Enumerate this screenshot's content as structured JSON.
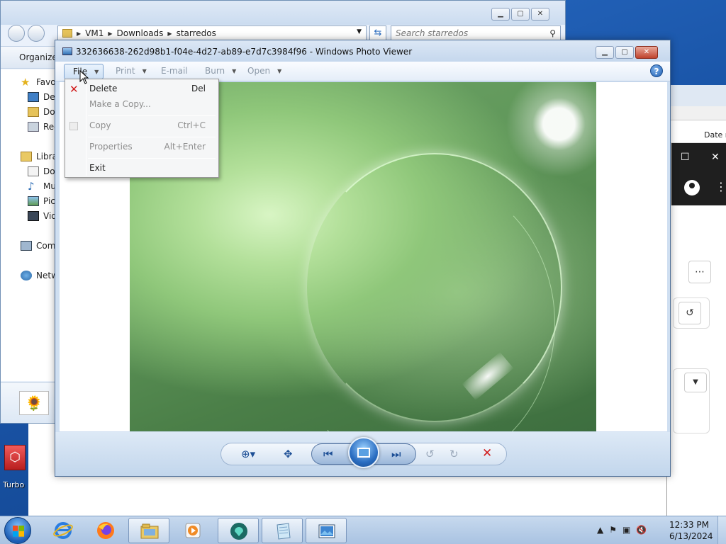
{
  "explorer": {
    "breadcrumb": [
      "VM1",
      "Downloads",
      "starredos"
    ],
    "search_placeholder": "Search starredos",
    "toolbar_organize": "Organize",
    "nav_items": [
      "Favor",
      "Des",
      "Dow",
      "Rec",
      "Libra",
      "Doc",
      "Mu",
      "Pict",
      "Vid",
      "Comp",
      "Netw"
    ]
  },
  "browser": {
    "column_header": "Date r"
  },
  "viewer": {
    "title": "332636638-262d98b1-f04e-4d27-ab89-e7d7c3984f96 - Windows Photo Viewer",
    "menus": {
      "file": "File",
      "print": "Print",
      "email": "E-mail",
      "burn": "Burn",
      "open": "Open"
    }
  },
  "file_menu": {
    "items": [
      {
        "label": "Delete",
        "shortcut": "Del",
        "enabled": true
      },
      {
        "label": "Make a Copy...",
        "shortcut": "",
        "enabled": false
      },
      {
        "label": "Copy",
        "shortcut": "Ctrl+C",
        "enabled": false
      },
      {
        "label": "Properties",
        "shortcut": "Alt+Enter",
        "enabled": false
      },
      {
        "label": "Exit",
        "shortcut": "",
        "enabled": true
      }
    ]
  },
  "desktop_icon": {
    "label": "Turbo"
  },
  "taskbar": {
    "time": "12:33 PM",
    "date": "6/13/2024"
  },
  "colors": {
    "delete_accent": "#d11c1c",
    "titlebar": "#c5d7ed"
  }
}
